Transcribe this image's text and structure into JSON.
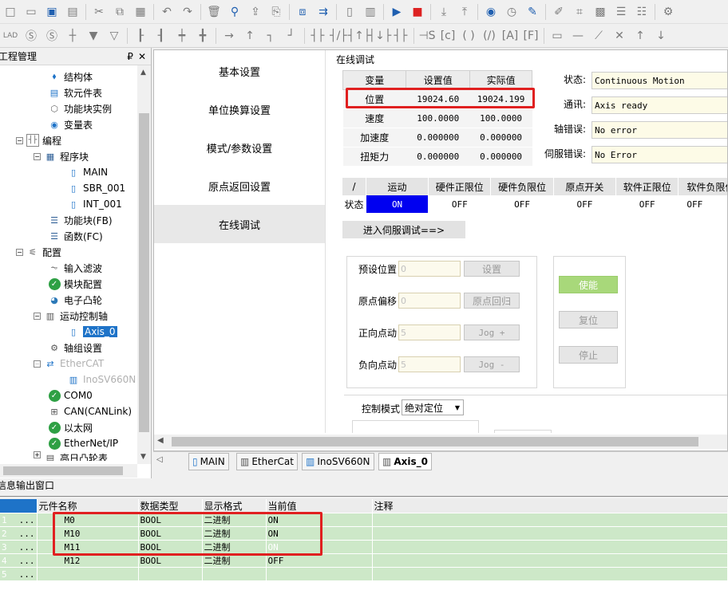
{
  "toolbar_icons_row1": [
    "new-icon",
    "open-icon",
    "save-icon",
    "save-all-icon",
    "cut-icon",
    "copy-icon",
    "paste-icon",
    "undo-icon",
    "redo-icon",
    "delete-icon",
    "search-icon",
    "upload-icon",
    "download-icon",
    "monitor-icon",
    "compile-icon",
    "file-icon",
    "file-list-icon",
    "run-icon",
    "stop-icon",
    "download-plc-icon",
    "upload-plc-icon",
    "webcam-icon",
    "clock-icon",
    "write-icon",
    "edit-icon",
    "network-icon",
    "grid-icon",
    "align-icon",
    "compare-icon"
  ],
  "project_panel": {
    "title": "工程管理",
    "pin": "₽",
    "close": "✕",
    "tree": [
      {
        "label": "结构体",
        "indent": 0
      },
      {
        "label": "软元件表",
        "indent": 0
      },
      {
        "label": "功能块实例",
        "indent": 0
      },
      {
        "label": "变量表",
        "indent": 0
      },
      {
        "label": "编程",
        "indent": 1
      },
      {
        "label": "程序块",
        "indent": 2
      },
      {
        "label": "MAIN",
        "indent": 3
      },
      {
        "label": "SBR_001",
        "indent": 3
      },
      {
        "label": "INT_001",
        "indent": 3
      },
      {
        "label": "功能块(FB)",
        "indent": 2
      },
      {
        "label": "函数(FC)",
        "indent": 2
      },
      {
        "label": "配置",
        "indent": 1
      },
      {
        "label": "输入滤波",
        "indent": 2
      },
      {
        "label": "模块配置",
        "indent": 2
      },
      {
        "label": "电子凸轮",
        "indent": 2
      },
      {
        "label": "运动控制轴",
        "indent": 2
      },
      {
        "label": "Axis_0",
        "indent": 3
      },
      {
        "label": "轴组设置",
        "indent": 2
      },
      {
        "label": "EtherCAT",
        "indent": 2
      },
      {
        "label": "InoSV660N",
        "indent": 3
      },
      {
        "label": "COM0",
        "indent": 2
      },
      {
        "label": "CAN(CANLink)",
        "indent": 2
      },
      {
        "label": "以太网",
        "indent": 2
      },
      {
        "label": "EtherNet/IP",
        "indent": 2
      },
      {
        "label": "高日凸轮表",
        "indent": 2
      }
    ]
  },
  "nav": {
    "items": [
      "基本设置",
      "单位换算设置",
      "模式/参数设置",
      "原点返回设置",
      "在线调试"
    ],
    "active": "在线调试"
  },
  "online_debug": {
    "title": "在线调试",
    "var_table": {
      "headers": [
        "变量",
        "设置值",
        "实际值"
      ],
      "rows": [
        [
          "位置",
          "19024.60",
          "19024.199"
        ],
        [
          "速度",
          "100.0000",
          "100.0000"
        ],
        [
          "加速度",
          "0.000000",
          "0.000000"
        ],
        [
          "扭矩力",
          "0.000000",
          "0.000000"
        ]
      ]
    },
    "status": {
      "state_label": "状态:",
      "state_value": "Continuous Motion",
      "comm_label": "通讯:",
      "comm_value": "Axis ready",
      "axis_err_label": "轴错误:",
      "axis_err_value": "No error",
      "servo_err_label": "伺服错误:",
      "servo_err_value": "No Error"
    },
    "axis_table": {
      "headers": [
        "/",
        "运动",
        "硬件正限位",
        "硬件负限位",
        "原点开关",
        "软件正限位",
        "软件负限位"
      ],
      "row_label": "状态",
      "values": [
        "ON",
        "OFF",
        "OFF",
        "OFF",
        "OFF",
        "OFF"
      ]
    },
    "servo_debug_button": "进入伺服调试==>",
    "preset_label": "预设位置",
    "preset_value": "0",
    "set_button": "设置",
    "origin_offset_label": "原点偏移",
    "origin_offset_value": "0",
    "origin_return_button": "原点回归",
    "jog_pos_label": "正向点动",
    "jog_pos_value": "5",
    "jog_pos_button": "Jog +",
    "jog_neg_label": "负向点动",
    "jog_neg_value": "5",
    "jog_neg_button": "Jog -",
    "enable_button": "使能",
    "reset_button": "复位",
    "stop_button": "停止",
    "control_mode_label": "控制模式",
    "control_mode_value": "绝对定位"
  },
  "tabs": [
    {
      "label": "MAIN",
      "active": false
    },
    {
      "label": "EtherCat",
      "active": false
    },
    {
      "label": "InoSV660N",
      "active": false
    },
    {
      "label": "Axis_0",
      "active": true
    }
  ],
  "output": {
    "title": "信息输出窗口",
    "headers": [
      "元件名称",
      "数据类型",
      "显示格式",
      "当前值",
      "注释"
    ],
    "rows": [
      {
        "n": "1",
        "dots": "...",
        "name": "M0",
        "type": "BOOL",
        "fmt": "二进制",
        "val": "ON",
        "note": ""
      },
      {
        "n": "2",
        "dots": "...",
        "name": "M10",
        "type": "BOOL",
        "fmt": "二进制",
        "val": "ON",
        "note": ""
      },
      {
        "n": "3",
        "dots": "...",
        "name": "M11",
        "type": "BOOL",
        "fmt": "二进制",
        "val": "ON",
        "note": ""
      },
      {
        "n": "4",
        "dots": "...",
        "name": "M12",
        "type": "BOOL",
        "fmt": "二进制",
        "val": "OFF",
        "note": ""
      },
      {
        "n": "5",
        "dots": "...",
        "name": "",
        "type": "",
        "fmt": "",
        "val": "",
        "note": ""
      }
    ]
  }
}
